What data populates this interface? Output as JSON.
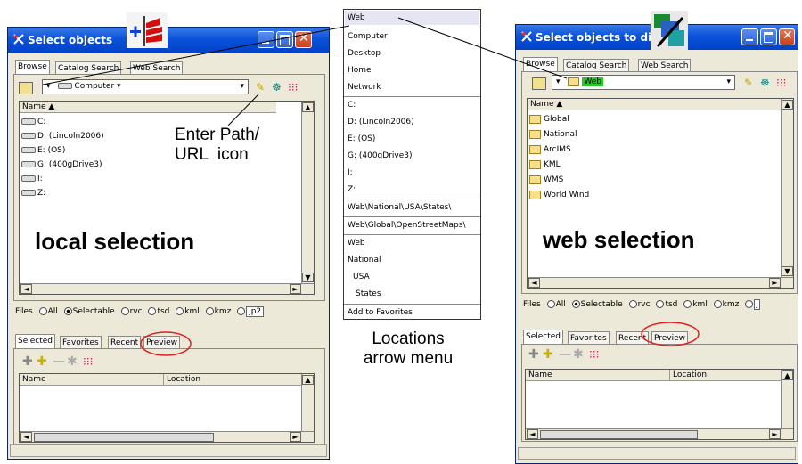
{
  "left_window": {
    "title": "Select objects",
    "tabs": [
      "Browse",
      "Catalog Search",
      "Web Search"
    ],
    "location_value": "Computer",
    "list_header": "Name ▲",
    "items": [
      "C:",
      "D: (Lincoln2006)",
      "E: (OS)",
      "G: (400gDrive3)",
      "I:",
      "Z:"
    ],
    "caption": "local selection",
    "files_label": "Files",
    "file_filters": [
      "All",
      "Selectable",
      "rvc",
      "tsd",
      "kml",
      "kmz",
      "jp2"
    ],
    "bottom_tabs": [
      "Selected",
      "Favorites",
      "Recent",
      "Preview"
    ],
    "columns": [
      "Name",
      "Location"
    ]
  },
  "right_window": {
    "title": "Select objects to disp",
    "tabs": [
      "Browse",
      "Catalog Search",
      "Web Search"
    ],
    "location_value": "Web",
    "list_header": "Name ▲",
    "items": [
      "Global",
      "National",
      "ArcIMS",
      "KML",
      "WMS",
      "World Wind"
    ],
    "caption": "web selection",
    "files_label": "Files",
    "file_filters": [
      "All",
      "Selectable",
      "rvc",
      "tsd",
      "kml",
      "kmz",
      "j"
    ],
    "bottom_tabs": [
      "Selected",
      "Favorites",
      "Recent",
      "Preview"
    ],
    "columns": [
      "Name",
      "Location"
    ]
  },
  "menu": {
    "items": [
      "Web",
      "Computer",
      "Desktop",
      "Home",
      "Network",
      "C:",
      "D: (Lincoln2006)",
      "E: (OS)",
      "G: (400gDrive3)",
      "I:",
      "Z:",
      "Web\\National\\USA\\States\\",
      "Web\\Global\\OpenStreetMaps\\",
      "Web",
      "National",
      "USA",
      "States",
      "Add to Favorites"
    ]
  },
  "annotations": {
    "enter_path": "Enter Path/\nURL  icon",
    "locations_menu": "Locations\narrow menu"
  },
  "colors": {
    "titlebar": "#0a52d8",
    "window_bg": "#ece9d8",
    "highlight_circle": "#e02020",
    "web_highlight": "#22cc22"
  }
}
